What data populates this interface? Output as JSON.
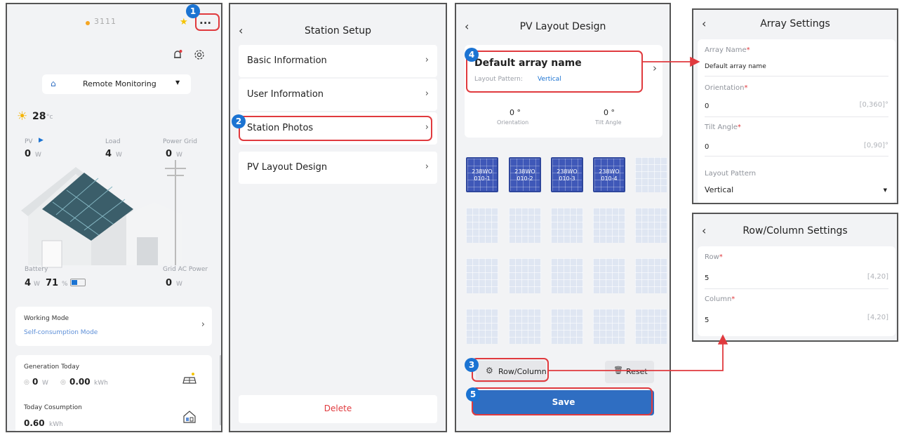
{
  "panel1": {
    "station_name": "3111",
    "more_label": "...",
    "monitor_label": "Remote Monitoring",
    "temperature": "28",
    "temp_unit": "°c",
    "pv_label": "PV",
    "pv_value": "0",
    "pv_unit": "W",
    "load_label": "Load",
    "load_value": "4",
    "load_unit": "W",
    "grid_label": "Power Grid",
    "grid_value": "0",
    "grid_unit": "W",
    "battery_label": "Battery",
    "battery_value": "4",
    "battery_unit": "W",
    "battery_soc": "71",
    "soc_unit": "%",
    "battery_soc_fraction": 0.4,
    "gridac_label": "Grid AC Power",
    "gridac_value": "0",
    "gridac_unit": "W",
    "working_mode_label": "Working Mode",
    "working_mode_value": "Self-consumption Mode",
    "gen_today_label": "Generation Today",
    "gen_today_power": "0",
    "gen_today_power_unit": "W",
    "gen_today_energy": "0.00",
    "gen_today_energy_unit": "kWh",
    "consumption_label": "Today Cosumption",
    "consumption_value": "0.60",
    "consumption_unit": "kWh"
  },
  "panel2": {
    "title": "Station Setup",
    "items": [
      "Basic Information",
      "User Information",
      "Station Photos",
      "PV Layout Design"
    ],
    "delete_label": "Delete"
  },
  "panel3": {
    "title": "PV Layout Design",
    "array_name": "Default array name",
    "layout_pattern_label": "Layout Pattern:",
    "layout_pattern_value": "Vertical",
    "orientation_value": "0 °",
    "orientation_label": "Orientation",
    "tilt_value": "0 °",
    "tilt_label": "Tilt Angle",
    "panels": [
      "238WO\n010-1",
      "238WO\n010-2",
      "238WO\n010-3",
      "238WO\n010-4"
    ],
    "row_column_label": "Row/Column",
    "reset_label": "Reset",
    "save_label": "Save"
  },
  "panel4": {
    "title": "Array Settings",
    "array_name_label": "Array Name",
    "array_name_value": "Default array name",
    "orientation_label": "Orientation",
    "orientation_value": "0",
    "orientation_range": "[0,360]°",
    "tilt_label": "Tilt Angle",
    "tilt_value": "0",
    "tilt_range": "[0,90]°",
    "layout_label": "Layout Pattern",
    "layout_value": "Vertical"
  },
  "panel5": {
    "title": "Row/Column Settings",
    "row_label": "Row",
    "row_value": "5",
    "row_range": "[4,20]",
    "column_label": "Column",
    "column_value": "5",
    "column_range": "[4,20]"
  },
  "badges": [
    "1",
    "2",
    "3",
    "4",
    "5"
  ],
  "required_mark": "*",
  "colors": {
    "accent": "#1b73d2",
    "highlight": "#e03a3e",
    "save_button": "#2f6ec2",
    "panel_blue": "#3f58b8"
  }
}
